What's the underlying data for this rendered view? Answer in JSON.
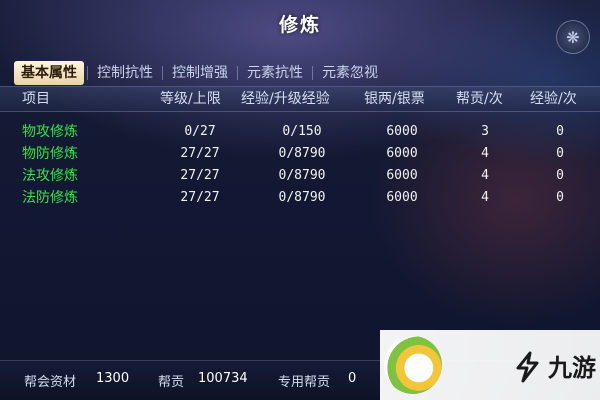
{
  "window": {
    "title": "修炼"
  },
  "tabs": [
    {
      "label": "基本属性",
      "active": true
    },
    {
      "label": "控制抗性",
      "active": false
    },
    {
      "label": "控制增强",
      "active": false
    },
    {
      "label": "元素抗性",
      "active": false
    },
    {
      "label": "元素忽视",
      "active": false
    }
  ],
  "table": {
    "headers": [
      "项目",
      "等级/上限",
      "经验/升级经验",
      "银两/银票",
      "帮贡/次",
      "经验/次"
    ],
    "rows": [
      {
        "name": "物攻修炼",
        "level": "0/27",
        "exp": "0/150",
        "silver": "6000",
        "contribution": "3",
        "exp_per": "0"
      },
      {
        "name": "物防修炼",
        "level": "27/27",
        "exp": "0/8790",
        "silver": "6000",
        "contribution": "4",
        "exp_per": "0"
      },
      {
        "name": "法攻修炼",
        "level": "27/27",
        "exp": "0/8790",
        "silver": "6000",
        "contribution": "4",
        "exp_per": "0"
      },
      {
        "name": "法防修炼",
        "level": "27/27",
        "exp": "0/8790",
        "silver": "6000",
        "contribution": "4",
        "exp_per": "0"
      }
    ]
  },
  "bottom": {
    "guild_material_label": "帮会资材",
    "guild_material_value": "1300",
    "contribution_label": "帮贡",
    "contribution_value": "100734",
    "special_contribution_label": "专用帮贡",
    "special_contribution_value": "0"
  },
  "watermark": {
    "text": "九游"
  },
  "colors": {
    "name_green": "#36e24a",
    "tab_active_bg": "#efdcae",
    "header_text": "#d7def3"
  }
}
